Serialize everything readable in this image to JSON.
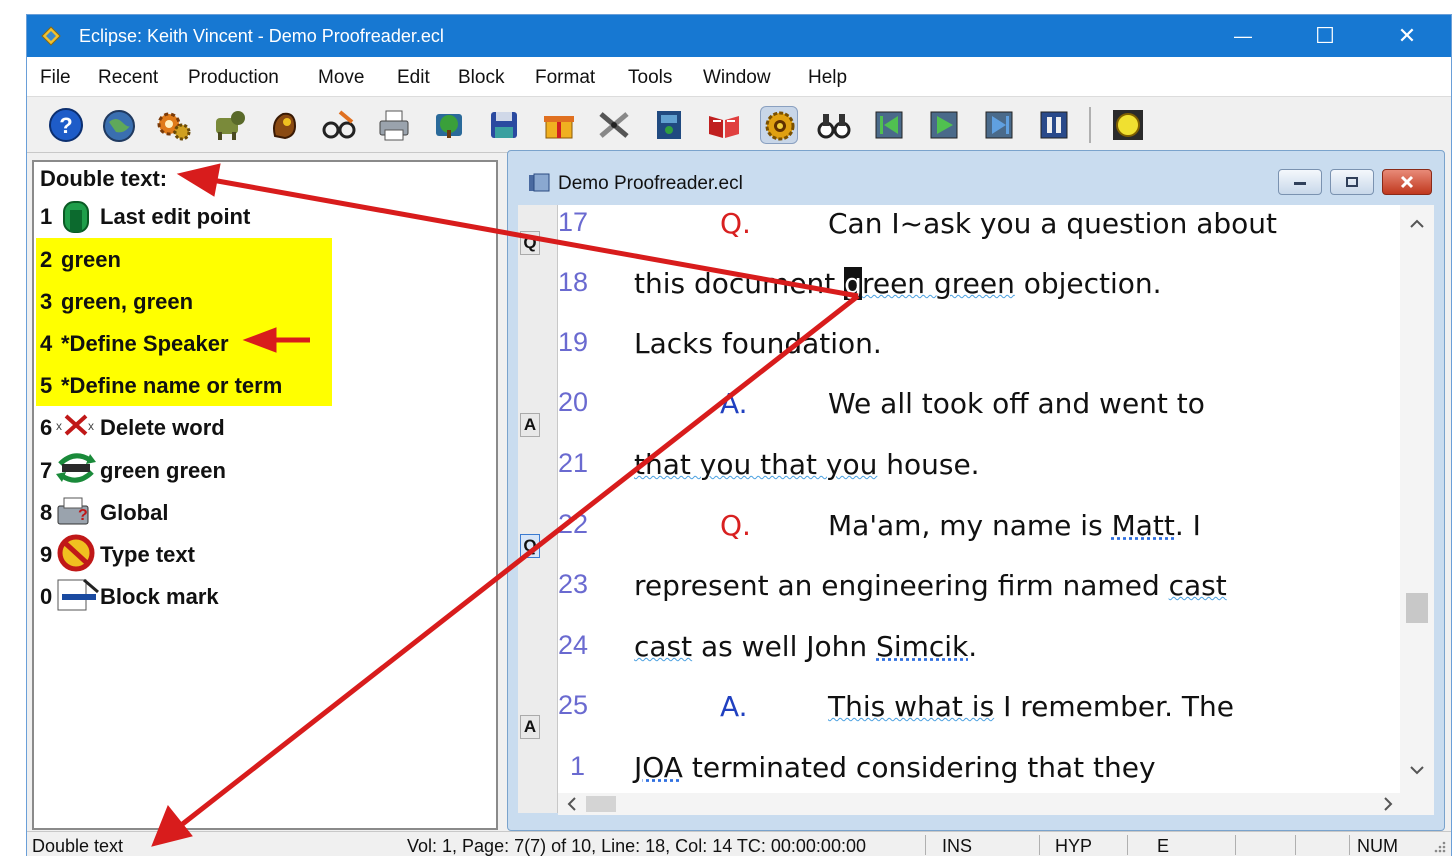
{
  "window": {
    "title": "Eclipse: Keith Vincent - Demo Proofreader.ecl",
    "minimize_glyph": "—",
    "maximize_glyph": "☐",
    "close_glyph": "✕"
  },
  "menu": {
    "items": [
      "File",
      "Recent",
      "Production",
      "Move",
      "Edit",
      "Block",
      "Format",
      "Tools",
      "Window",
      "Help"
    ]
  },
  "toolbar": {
    "icons": [
      "help-icon",
      "globe-icon",
      "gears-icon",
      "dog-icon",
      "hand-icon",
      "glasses-icon",
      "printer-icon",
      "tree-icon",
      "disk-icon",
      "gift-icon",
      "cutter-icon",
      "book-icon",
      "open-book-icon",
      "sun-icon",
      "binoculars-icon",
      "rewind-icon",
      "play-icon",
      "step-play-icon",
      "pause-icon",
      "circle-icon"
    ]
  },
  "left_panel": {
    "title": "Double text:",
    "items": [
      {
        "num": "1",
        "label": "Last edit point",
        "icon": "door-icon"
      },
      {
        "num": "2",
        "label": "green",
        "icon": ""
      },
      {
        "num": "3",
        "label": "green, green",
        "icon": ""
      },
      {
        "num": "4",
        "label": "*Define Speaker",
        "icon": ""
      },
      {
        "num": "5",
        "label": "*Define name or term",
        "icon": ""
      },
      {
        "num": "6",
        "label": "Delete word",
        "icon": "delete-icon"
      },
      {
        "num": "7",
        "label": "green green",
        "icon": "swap-icon"
      },
      {
        "num": "8",
        "label": "Global",
        "icon": "global-icon"
      },
      {
        "num": "9",
        "label": "Type text",
        "icon": "no-type-icon"
      },
      {
        "num": "0",
        "label": "Block mark",
        "icon": "block-mark-icon"
      }
    ],
    "highlight_color": "#ffff00"
  },
  "document": {
    "title": "Demo Proofreader.ecl",
    "lines": [
      {
        "num": "17",
        "marker": "Q",
        "q": "Q.",
        "text": "Can I~ask you a question about"
      },
      {
        "num": "18",
        "marker": "",
        "text_pre": "this document ",
        "cursor": "g",
        "text_mid": "reen green",
        "text_post": " objection."
      },
      {
        "num": "19",
        "marker": "",
        "text": "Lacks foundation."
      },
      {
        "num": "20",
        "marker": "A",
        "a": "A.",
        "text": "We all took off and went to"
      },
      {
        "num": "21",
        "marker": "",
        "text_wavy": "that you that you",
        "text_post": " house."
      },
      {
        "num": "22",
        "marker": "Q",
        "q": "Q.",
        "text_pre": "Ma'am, my name is ",
        "text_wavy": "Matt",
        "text_post": ".  I"
      },
      {
        "num": "23",
        "marker": "",
        "text_pre": "represent an engineering firm named ",
        "text_wavy": "cast"
      },
      {
        "num": "24",
        "marker": "",
        "text_wavy": "cast",
        "text_pre": " as well John ",
        "text_wavy2": "Simcik",
        "text_post": "."
      },
      {
        "num": "25",
        "marker": "A",
        "a": "A.",
        "text_wavy": "This what is",
        "text_post": " I remember.  The"
      },
      {
        "num": "1",
        "marker": "",
        "text_wavy": "JOA",
        "text_post": " terminated considering that they"
      }
    ],
    "colors": {
      "question": "#d82020",
      "answer": "#2040c0",
      "line_number": "#6a6ad0"
    }
  },
  "status": {
    "mode_text": "Double text",
    "position": "Vol: 1, Page: 7(7) of 10, Line: 18, Col: 14 TC: 00:00:00:00",
    "ins": "INS",
    "hyp": "HYP",
    "e": "E",
    "num": "NUM"
  },
  "annotations": {
    "arrow_color": "#d81c1c"
  }
}
